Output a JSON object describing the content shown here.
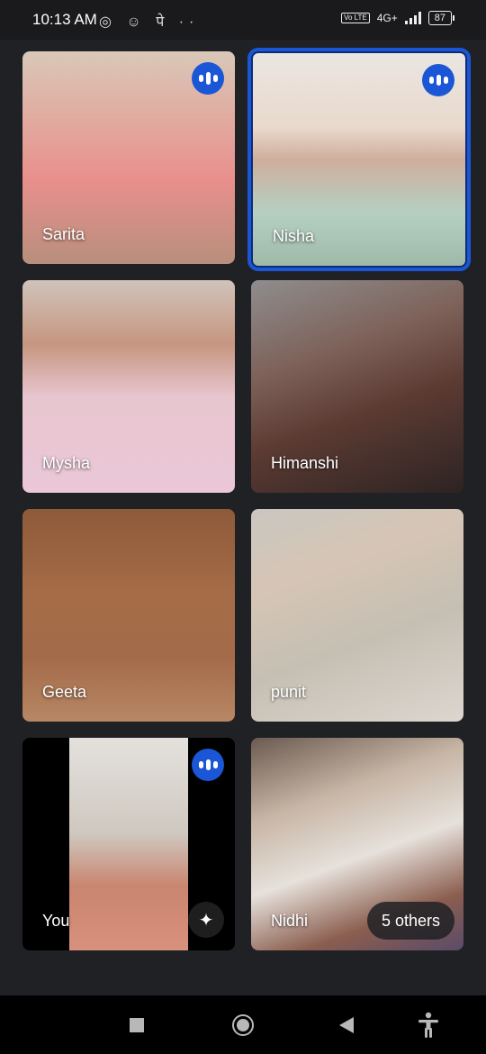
{
  "status_bar": {
    "time": "10:13 AM",
    "left_icons": "◎ ☺ पे ··",
    "network": "4G+",
    "volte": "Vo LTE",
    "battery": "87"
  },
  "participants": [
    {
      "name": "Sarita",
      "speaking": true
    },
    {
      "name": "Nisha",
      "speaking": true,
      "active": true
    },
    {
      "name": "Mysha",
      "speaking": false
    },
    {
      "name": "Himanshi",
      "speaking": false
    },
    {
      "name": "Geeta",
      "speaking": false
    },
    {
      "name": "punit",
      "speaking": false
    },
    {
      "name": "You",
      "speaking": true
    },
    {
      "name": "Nidhi",
      "speaking": false
    }
  ],
  "others_label": "5 others",
  "colors": {
    "background": "#202124",
    "active_border": "#1a56d6",
    "speak_badge": "#1a56d6"
  },
  "icons": {
    "speaking": "audio-bars-icon",
    "effects": "sparkle-icon",
    "nav_recents": "square-icon",
    "nav_home": "circle-icon",
    "nav_back": "triangle-back-icon",
    "accessibility": "accessibility-icon"
  }
}
